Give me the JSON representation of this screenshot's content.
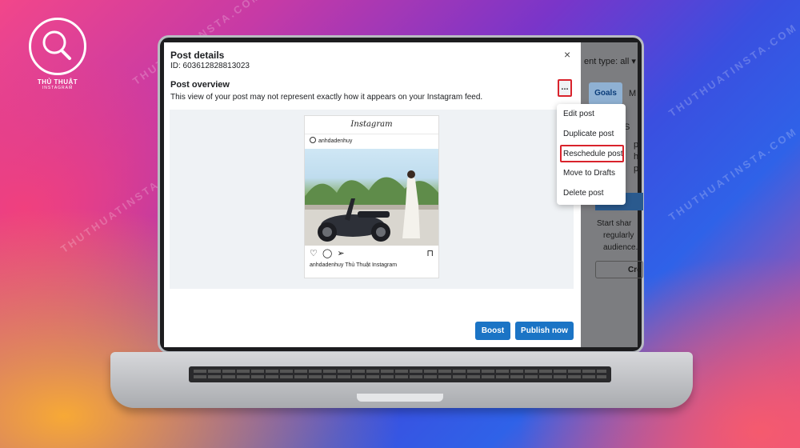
{
  "logo": {
    "line1": "THỦ THUẬT",
    "line2": "INSTAGRAM"
  },
  "watermark": "THUTHUATINSTA.COM",
  "modal": {
    "title": "Post details",
    "id_text": "ID: 603612828813023",
    "close": "×",
    "overview_title": "Post overview",
    "overview_desc": "This view of your post may not represent exactly how it appears on your Instagram feed.",
    "dots": "..."
  },
  "instagram_card": {
    "brand": "Instagram",
    "username": "anhdadenhuy",
    "caption_user": "anhdadenhuy",
    "caption_text": "Thủ Thuật Instagram"
  },
  "dropdown_menu": {
    "items": [
      "Edit post",
      "Duplicate post",
      "Reschedule post",
      "Move to Drafts",
      "Delete post"
    ],
    "highlighted": "Reschedule post"
  },
  "buttons": {
    "boost": "Boost",
    "publish": "Publish now"
  },
  "background_app": {
    "content_type": "ent type: all",
    "goals_tab": "Goals",
    "tab_m": "M",
    "start_line1": "Start shar",
    "start_line2": "regularly",
    "start_line3": "audience.",
    "create_btn": "Cre",
    "fragments": [
      "S",
      "p",
      "h",
      "p"
    ]
  },
  "colors": {
    "accent": "#1b74c5",
    "highlight": "#d9232c"
  }
}
